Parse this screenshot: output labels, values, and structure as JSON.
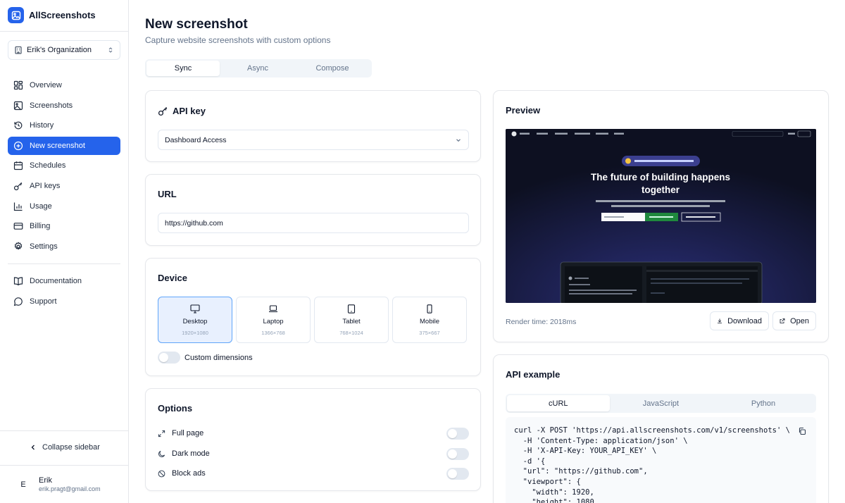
{
  "app": {
    "name": "AllScreenshots"
  },
  "org": {
    "name": "Erik's Organization"
  },
  "nav": [
    {
      "label": "Overview",
      "icon": "grid-icon"
    },
    {
      "label": "Screenshots",
      "icon": "image-icon"
    },
    {
      "label": "History",
      "icon": "history-icon"
    },
    {
      "label": "New screenshot",
      "icon": "plus-circle-icon",
      "active": true
    },
    {
      "label": "Schedules",
      "icon": "calendar-icon"
    },
    {
      "label": "API keys",
      "icon": "key-icon"
    },
    {
      "label": "Usage",
      "icon": "bar-chart-icon"
    },
    {
      "label": "Billing",
      "icon": "credit-card-icon"
    },
    {
      "label": "Settings",
      "icon": "gear-icon"
    }
  ],
  "nav_secondary": [
    {
      "label": "Documentation",
      "icon": "book-icon"
    },
    {
      "label": "Support",
      "icon": "chat-icon"
    }
  ],
  "sidebar": {
    "collapse_label": "Collapse sidebar"
  },
  "user": {
    "initial": "E",
    "name": "Erik",
    "email": "erik.pragt@gmail.com"
  },
  "page": {
    "title": "New screenshot",
    "subtitle": "Capture website screenshots with custom options"
  },
  "mode_tabs": [
    "Sync",
    "Async",
    "Compose"
  ],
  "api_key": {
    "title": "API key",
    "selected": "Dashboard Access"
  },
  "url": {
    "title": "URL",
    "value": "https://github.com"
  },
  "device": {
    "title": "Device",
    "options": [
      {
        "name": "Desktop",
        "dims": "1920×1080",
        "selected": true
      },
      {
        "name": "Laptop",
        "dims": "1366×768"
      },
      {
        "name": "Tablet",
        "dims": "768×1024"
      },
      {
        "name": "Mobile",
        "dims": "375×667"
      }
    ],
    "custom_dimensions_label": "Custom dimensions"
  },
  "options": {
    "title": "Options",
    "items": [
      {
        "label": "Full page",
        "icon": "expand-icon"
      },
      {
        "label": "Dark mode",
        "icon": "moon-icon"
      },
      {
        "label": "Block ads",
        "icon": "ban-icon"
      }
    ]
  },
  "preview": {
    "title": "Preview",
    "render_time": "Render time: 2018ms",
    "download_label": "Download",
    "open_label": "Open",
    "screenshot_headline": "The future of building happens together"
  },
  "api_example": {
    "title": "API example",
    "tabs": [
      "cURL",
      "JavaScript",
      "Python"
    ],
    "code": "curl -X POST 'https://api.allscreenshots.com/v1/screenshots' \\\n  -H 'Content-Type: application/json' \\\n  -H 'X-API-Key: YOUR_API_KEY' \\\n  -d '{\n  \"url\": \"https://github.com\",\n  \"viewport\": {\n    \"width\": 1920,\n    \"height\": 1080,"
  },
  "colors": {
    "accent": "#2563eb",
    "preview_bg": "#0d1021"
  }
}
